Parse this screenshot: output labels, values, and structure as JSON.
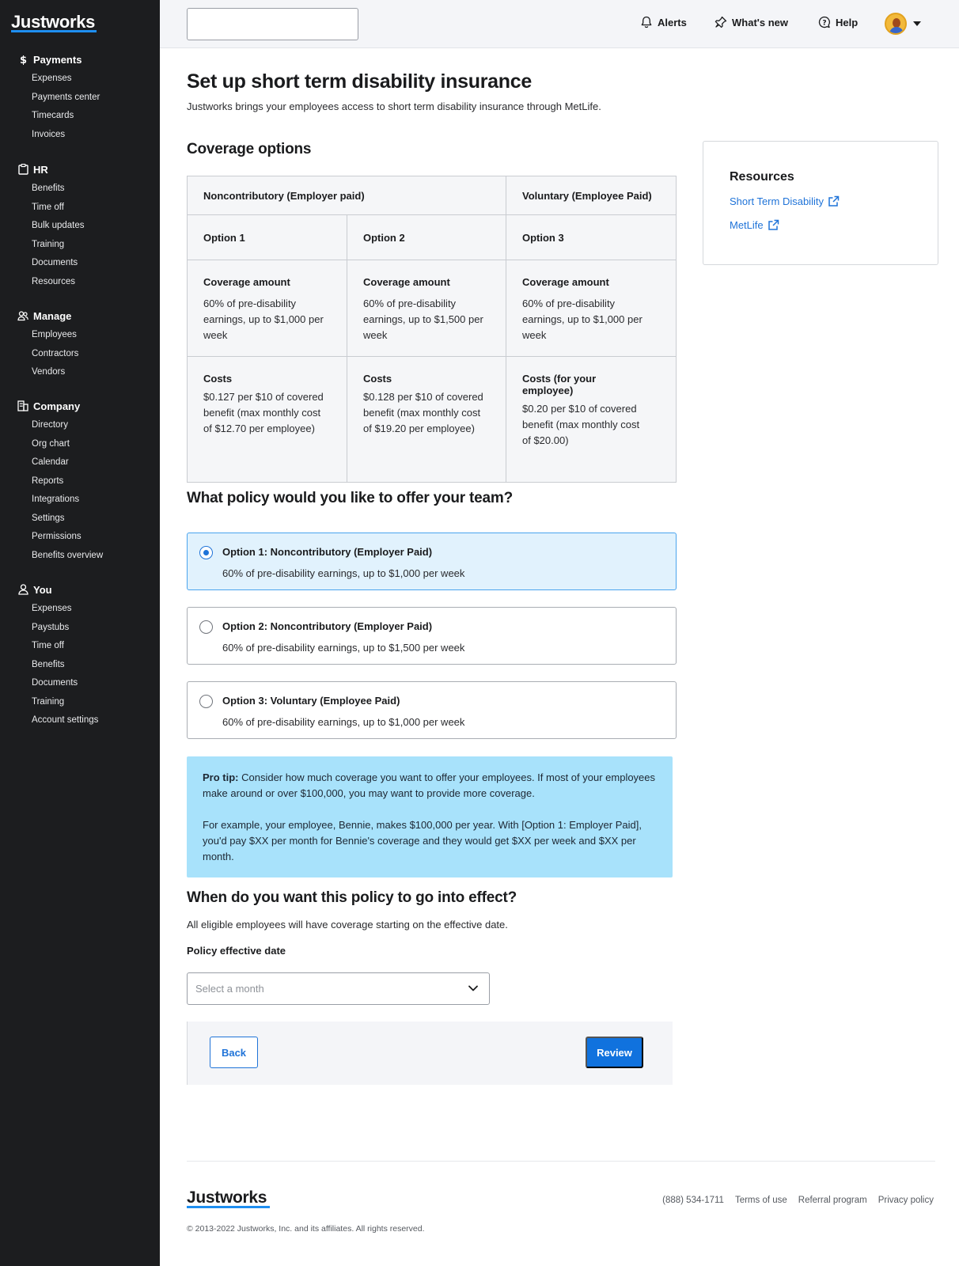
{
  "brand": "Justworks",
  "sidebar": {
    "sections": [
      {
        "icon": "dollar-icon",
        "label": "Payments",
        "items": [
          "Expenses",
          "Payments center",
          "Timecards",
          "Invoices"
        ]
      },
      {
        "icon": "clipboard-icon",
        "label": "HR",
        "items": [
          "Benefits",
          "Time off",
          "Bulk updates",
          "Training",
          "Documents",
          "Resources"
        ]
      },
      {
        "icon": "people-icon",
        "label": "Manage",
        "items": [
          "Employees",
          "Contractors",
          "Vendors"
        ]
      },
      {
        "icon": "building-icon",
        "label": "Company",
        "items": [
          "Directory",
          "Org chart",
          "Calendar",
          "Reports",
          "Integrations",
          "Settings",
          "Permissions",
          "Benefits overview"
        ]
      },
      {
        "icon": "person-icon",
        "label": "You",
        "items": [
          "Expenses",
          "Paystubs",
          "Time off",
          "Benefits",
          "Documents",
          "Training",
          "Account settings"
        ]
      }
    ]
  },
  "header": {
    "search_value": "",
    "alerts_label": "Alerts",
    "whats_new_label": "What's new",
    "help_label": "Help"
  },
  "main": {
    "title": "Set up short term disability insurance",
    "subtitle": "Justworks brings your employees access to short term disability insurance through MetLife.",
    "coverage_heading": "Coverage options",
    "table": {
      "group_noncontrib": "Noncontributory (Employer paid)",
      "group_voluntary": "Voluntary (Employee Paid)",
      "options": [
        {
          "name": "Option 1",
          "coverage_title": "Coverage amount",
          "coverage_text": "60% of pre-disability earnings, up to $1,000 per week",
          "costs_title": "Costs",
          "costs_text": "$0.127 per $10 of covered benefit (max monthly cost of $12.70 per employee)"
        },
        {
          "name": "Option 2",
          "coverage_title": "Coverage amount",
          "coverage_text": "60% of pre-disability earnings, up to $1,500 per week",
          "costs_title": "Costs",
          "costs_text": "$0.128 per $10 of covered benefit (max monthly cost of $19.20 per employee)"
        },
        {
          "name": "Option 3",
          "coverage_title": "Coverage amount",
          "coverage_text": "60% of pre-disability earnings, up to $1,000 per week",
          "costs_title": "Costs (for your employee)",
          "costs_text": "$0.20 per $10 of covered benefit (max monthly cost of $20.00)"
        }
      ]
    },
    "policy_question": "What policy would you like to offer your team?",
    "policy_options": [
      {
        "title": "Option 1: Noncontributory (Employer Paid)",
        "desc": "60% of pre-disability earnings, up to $1,000 per week",
        "selected": true
      },
      {
        "title": "Option 2: Noncontributory (Employer Paid)",
        "desc": "60% of pre-disability earnings, up to $1,500 per week",
        "selected": false
      },
      {
        "title": "Option 3: Voluntary (Employee Paid)",
        "desc": "60% of pre-disability earnings, up to $1,000 per week",
        "selected": false
      }
    ],
    "pro_tip": {
      "label": "Pro tip:",
      "text": " Consider how much coverage you want to offer your employees. If most of your employees make around or over $100,000, you may want to provide more coverage.",
      "example": "For example, your employee, Bennie, makes $100,000 per year. With [Option 1: Employer Paid], you'd pay $XX per month for Bennie's coverage and they would get $XX per week and $XX per month."
    },
    "effective": {
      "heading": "When do you want this policy to go into effect?",
      "sub": "All eligible employees will have coverage starting on the effective date.",
      "field_label": "Policy effective date",
      "placeholder": "Select a month"
    },
    "actions": {
      "back": "Back",
      "review": "Review"
    }
  },
  "resources": {
    "title": "Resources",
    "links": [
      "Short Term Disability",
      "MetLife"
    ]
  },
  "footer": {
    "logo": "Justworks",
    "links": [
      "(888) 534-1711",
      "Terms of use",
      "Referral program",
      "Privacy policy"
    ],
    "copyright": "© 2013-2022 Justworks, Inc. and its affiliates. All rights reserved."
  },
  "colors": {
    "sidebar_bg": "#1c1d1f",
    "accent": "#1f73d8",
    "selected_option_bg": "#e1f2fd",
    "pro_tip_bg": "#a8e2fb",
    "primary_button": "#1072de"
  }
}
